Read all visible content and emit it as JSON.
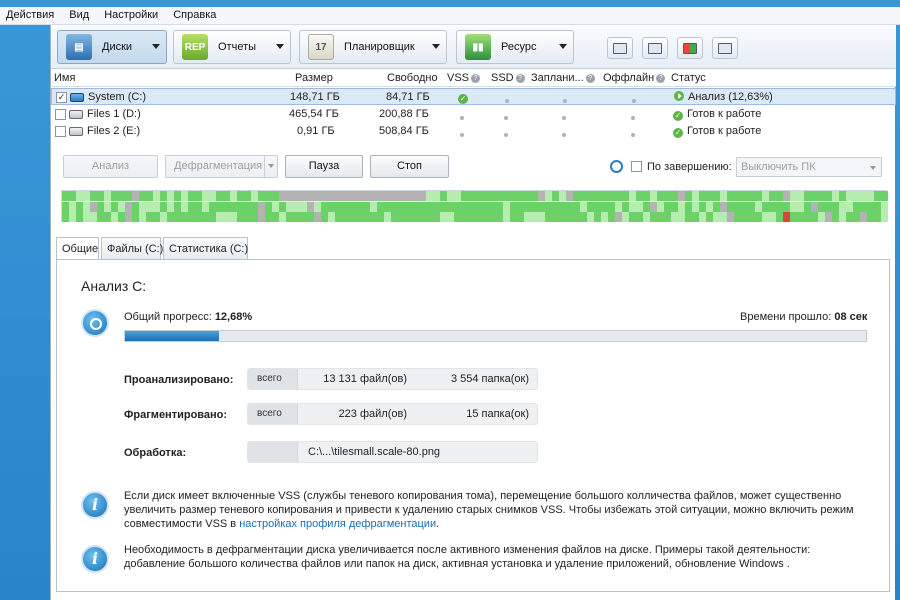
{
  "menu": [
    "Действия",
    "Вид",
    "Настройки",
    "Справка"
  ],
  "toolbar": {
    "tabs": [
      {
        "label": "Диски",
        "icon": "disk-icon",
        "color": "#3c7fc0"
      },
      {
        "label": "Отчеты",
        "icon": "report-icon",
        "color": "#8cc63e"
      },
      {
        "label": "Планировщик",
        "icon": "calendar-icon",
        "color": "#e9e9e0"
      },
      {
        "label": "Ресурс",
        "icon": "resource-icon",
        "color": "#4aa04a"
      }
    ],
    "small_buttons": [
      "properties-icon",
      "chart-icon",
      "windows-icon",
      "settings-icon"
    ]
  },
  "drives": {
    "headers": {
      "name": "Имя",
      "size": "Размер",
      "free": "Свободно",
      "vss": "VSS",
      "ssd": "SSD",
      "sched": "Заплани...",
      "offline": "Оффлайн",
      "status": "Статус"
    },
    "rows": [
      {
        "checked": true,
        "name": "System (C:)",
        "size": "148,71 ГБ",
        "free": "84,71 ГБ",
        "status": "Анализ (12,63%)",
        "selected": true
      },
      {
        "checked": false,
        "name": "Files 1 (D:)",
        "size": "465,54 ГБ",
        "free": "200,88 ГБ",
        "status": "Готов к работе",
        "selected": false
      },
      {
        "checked": false,
        "name": "Files 2 (E:)",
        "size": "0,91 ГБ",
        "free": "508,84 ГБ",
        "status": "Готов к работе",
        "selected": false
      }
    ]
  },
  "actions": {
    "analyze": "Анализ",
    "defrag": "Дефрагментация",
    "pause": "Пауза",
    "stop": "Стоп",
    "on_finish_label": "По завершению:",
    "on_finish_value": "Выключить ПК"
  },
  "tabs": [
    "Общие",
    "Файлы (C:)",
    "Статистика (C:)"
  ],
  "analysis": {
    "title": "Анализ C:",
    "progress_label": "Общий прогресс:",
    "progress_value": "12,68%",
    "progress_fraction": 0.1268,
    "elapsed_label": "Времени прошло:",
    "elapsed_value": "08 сек",
    "analyzed_label": "Проанализировано:",
    "analyzed_total": "всего",
    "analyzed_files": "13 131 файл(ов)",
    "analyzed_folders": "3 554 папка(ок)",
    "fragmented_label": "Фрагментировано:",
    "fragmented_total": "всего",
    "fragmented_files": "223 файл(ов)",
    "fragmented_folders": "15 папка(ок)",
    "processing_label": "Обработка:",
    "processing_value": "C:\\...\\tilesmall.scale-80.png"
  },
  "info": {
    "vss_text": "Если диск имеет включенные VSS (службы теневого копирования тома), перемещение большого колличества файлов, может существенно увеличить размер теневого копирования и привести к удалению старых снимков VSS. Чтобы избежать этой ситуации, можно включить режим совместимости VSS в",
    "vss_link": "настройках профиля дефрагментации",
    "vss_tail": ".",
    "need_text": "Необходимость в дефрагментации диска увеличивается после активного изменения файлов на диске. Примеры такой деятельности: добавление большого количества файлов или папок на диск, активная установка и удаление приложений, обновление Windows ."
  },
  "colors": {
    "accent": "#1c6fb4",
    "ok": "#5bb543",
    "map_green": "#6dd16a",
    "map_light": "#b6ecb0",
    "map_gray": "#b3b3b3",
    "map_red": "#d9443b"
  }
}
